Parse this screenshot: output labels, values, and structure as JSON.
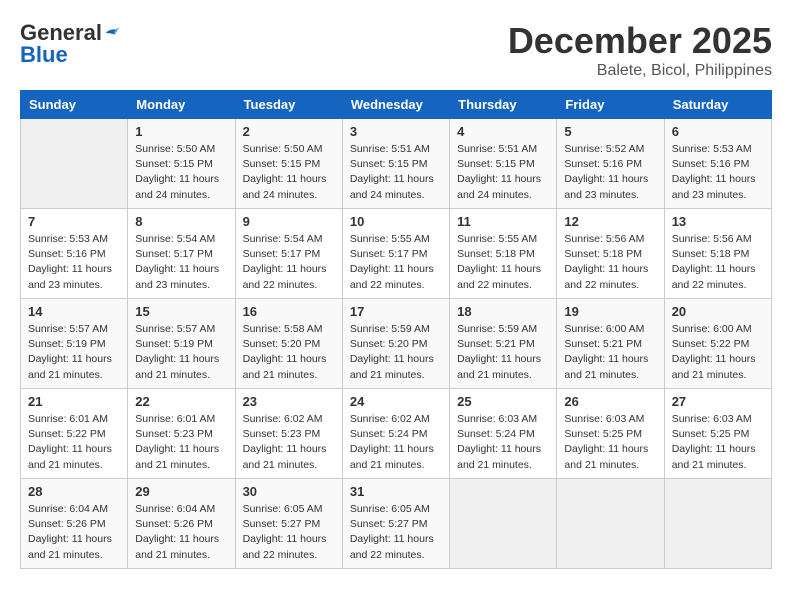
{
  "header": {
    "logo_general": "General",
    "logo_blue": "Blue",
    "month": "December 2025",
    "location": "Balete, Bicol, Philippines"
  },
  "weekdays": [
    "Sunday",
    "Monday",
    "Tuesday",
    "Wednesday",
    "Thursday",
    "Friday",
    "Saturday"
  ],
  "weeks": [
    [
      {
        "day": "",
        "empty": true
      },
      {
        "day": "1",
        "sunrise": "5:50 AM",
        "sunset": "5:15 PM",
        "daylight": "11 hours and 24 minutes."
      },
      {
        "day": "2",
        "sunrise": "5:50 AM",
        "sunset": "5:15 PM",
        "daylight": "11 hours and 24 minutes."
      },
      {
        "day": "3",
        "sunrise": "5:51 AM",
        "sunset": "5:15 PM",
        "daylight": "11 hours and 24 minutes."
      },
      {
        "day": "4",
        "sunrise": "5:51 AM",
        "sunset": "5:15 PM",
        "daylight": "11 hours and 24 minutes."
      },
      {
        "day": "5",
        "sunrise": "5:52 AM",
        "sunset": "5:16 PM",
        "daylight": "11 hours and 23 minutes."
      },
      {
        "day": "6",
        "sunrise": "5:53 AM",
        "sunset": "5:16 PM",
        "daylight": "11 hours and 23 minutes."
      }
    ],
    [
      {
        "day": "7",
        "sunrise": "5:53 AM",
        "sunset": "5:16 PM",
        "daylight": "11 hours and 23 minutes."
      },
      {
        "day": "8",
        "sunrise": "5:54 AM",
        "sunset": "5:17 PM",
        "daylight": "11 hours and 23 minutes."
      },
      {
        "day": "9",
        "sunrise": "5:54 AM",
        "sunset": "5:17 PM",
        "daylight": "11 hours and 22 minutes."
      },
      {
        "day": "10",
        "sunrise": "5:55 AM",
        "sunset": "5:17 PM",
        "daylight": "11 hours and 22 minutes."
      },
      {
        "day": "11",
        "sunrise": "5:55 AM",
        "sunset": "5:18 PM",
        "daylight": "11 hours and 22 minutes."
      },
      {
        "day": "12",
        "sunrise": "5:56 AM",
        "sunset": "5:18 PM",
        "daylight": "11 hours and 22 minutes."
      },
      {
        "day": "13",
        "sunrise": "5:56 AM",
        "sunset": "5:18 PM",
        "daylight": "11 hours and 22 minutes."
      }
    ],
    [
      {
        "day": "14",
        "sunrise": "5:57 AM",
        "sunset": "5:19 PM",
        "daylight": "11 hours and 21 minutes."
      },
      {
        "day": "15",
        "sunrise": "5:57 AM",
        "sunset": "5:19 PM",
        "daylight": "11 hours and 21 minutes."
      },
      {
        "day": "16",
        "sunrise": "5:58 AM",
        "sunset": "5:20 PM",
        "daylight": "11 hours and 21 minutes."
      },
      {
        "day": "17",
        "sunrise": "5:59 AM",
        "sunset": "5:20 PM",
        "daylight": "11 hours and 21 minutes."
      },
      {
        "day": "18",
        "sunrise": "5:59 AM",
        "sunset": "5:21 PM",
        "daylight": "11 hours and 21 minutes."
      },
      {
        "day": "19",
        "sunrise": "6:00 AM",
        "sunset": "5:21 PM",
        "daylight": "11 hours and 21 minutes."
      },
      {
        "day": "20",
        "sunrise": "6:00 AM",
        "sunset": "5:22 PM",
        "daylight": "11 hours and 21 minutes."
      }
    ],
    [
      {
        "day": "21",
        "sunrise": "6:01 AM",
        "sunset": "5:22 PM",
        "daylight": "11 hours and 21 minutes."
      },
      {
        "day": "22",
        "sunrise": "6:01 AM",
        "sunset": "5:23 PM",
        "daylight": "11 hours and 21 minutes."
      },
      {
        "day": "23",
        "sunrise": "6:02 AM",
        "sunset": "5:23 PM",
        "daylight": "11 hours and 21 minutes."
      },
      {
        "day": "24",
        "sunrise": "6:02 AM",
        "sunset": "5:24 PM",
        "daylight": "11 hours and 21 minutes."
      },
      {
        "day": "25",
        "sunrise": "6:03 AM",
        "sunset": "5:24 PM",
        "daylight": "11 hours and 21 minutes."
      },
      {
        "day": "26",
        "sunrise": "6:03 AM",
        "sunset": "5:25 PM",
        "daylight": "11 hours and 21 minutes."
      },
      {
        "day": "27",
        "sunrise": "6:03 AM",
        "sunset": "5:25 PM",
        "daylight": "11 hours and 21 minutes."
      }
    ],
    [
      {
        "day": "28",
        "sunrise": "6:04 AM",
        "sunset": "5:26 PM",
        "daylight": "11 hours and 21 minutes."
      },
      {
        "day": "29",
        "sunrise": "6:04 AM",
        "sunset": "5:26 PM",
        "daylight": "11 hours and 21 minutes."
      },
      {
        "day": "30",
        "sunrise": "6:05 AM",
        "sunset": "5:27 PM",
        "daylight": "11 hours and 22 minutes."
      },
      {
        "day": "31",
        "sunrise": "6:05 AM",
        "sunset": "5:27 PM",
        "daylight": "11 hours and 22 minutes."
      },
      {
        "day": "",
        "empty": true
      },
      {
        "day": "",
        "empty": true
      },
      {
        "day": "",
        "empty": true
      }
    ]
  ],
  "labels": {
    "sunrise": "Sunrise:",
    "sunset": "Sunset:",
    "daylight": "Daylight:"
  }
}
